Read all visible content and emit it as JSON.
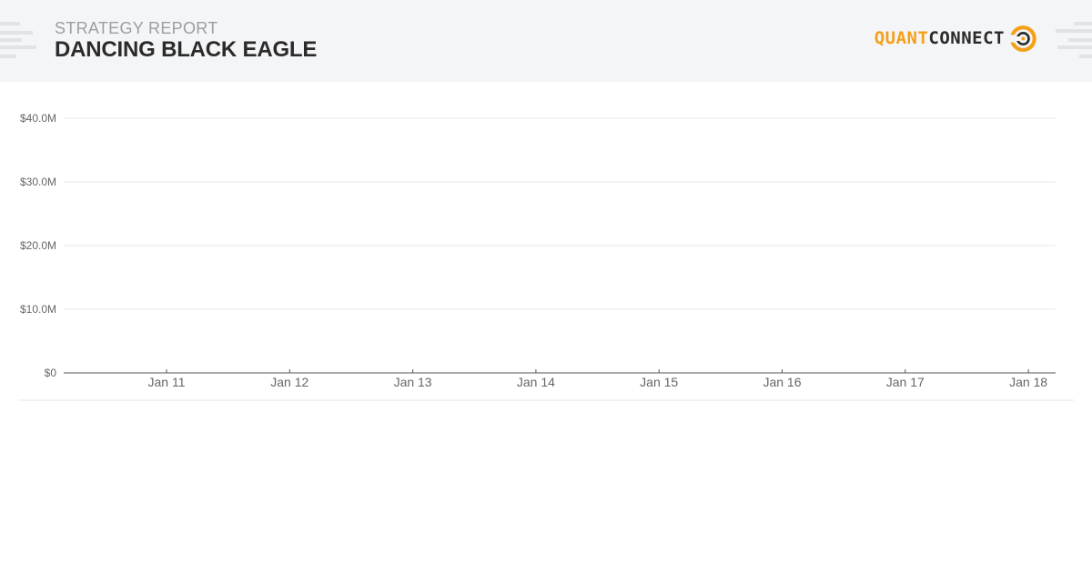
{
  "header": {
    "label": "STRATEGY REPORT",
    "title": "DANCING BLACK EAGLE",
    "logo_quant": "QUANT",
    "logo_connect": "CONNECT",
    "logo_icon": "quantconnect-logo-icon"
  },
  "colors": {
    "header_bg": "#f4f5f7",
    "brand_orange": "#f5a019",
    "title_text": "#2b2b2b",
    "grid": "#e6e7ea",
    "axis": "#555555",
    "tick_text": "#666666"
  },
  "chart_data": {
    "type": "area",
    "title": "",
    "xlabel": "",
    "ylabel": "",
    "x_tick_labels": [
      "Jan 11",
      "Jan 12",
      "Jan 13",
      "Jan 14",
      "Jan 15",
      "Jan 16",
      "Jan 17",
      "Jan 18"
    ],
    "y_tick_values": [
      0,
      10000000,
      20000000,
      30000000,
      40000000
    ],
    "y_tick_labels": [
      "$0",
      "$10.0M",
      "$20.0M",
      "$30.0M",
      "$40.0M"
    ],
    "ylim": [
      0,
      40000000
    ],
    "grid": true,
    "legend": "none",
    "series": []
  }
}
